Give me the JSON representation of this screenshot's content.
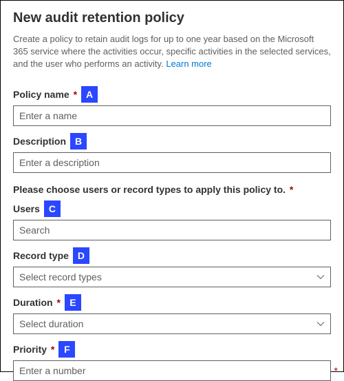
{
  "header": {
    "title": "New audit retention policy",
    "intro": "Create a policy to retain audit logs for up to one year based on the Microsoft 365 service where the activities occur, specific activities in the selected services, and the user who performs an activity. ",
    "learn_more": "Learn more"
  },
  "fields": {
    "policy_name": {
      "label": "Policy name",
      "required": "*",
      "badge": "A",
      "placeholder": "Enter a name"
    },
    "description": {
      "label": "Description",
      "badge": "B",
      "placeholder": "Enter a description"
    },
    "section_title": "Please choose users or record types to apply this policy to.",
    "section_required": "*",
    "users": {
      "label": "Users",
      "badge": "C",
      "placeholder": "Search"
    },
    "record_type": {
      "label": "Record type",
      "badge": "D",
      "placeholder": "Select record types"
    },
    "duration": {
      "label": "Duration",
      "required": "*",
      "badge": "E",
      "placeholder": "Select duration"
    },
    "priority": {
      "label": "Priority",
      "required": "*",
      "badge": "F",
      "placeholder": "Enter a number",
      "trailing_required": "*"
    }
  }
}
